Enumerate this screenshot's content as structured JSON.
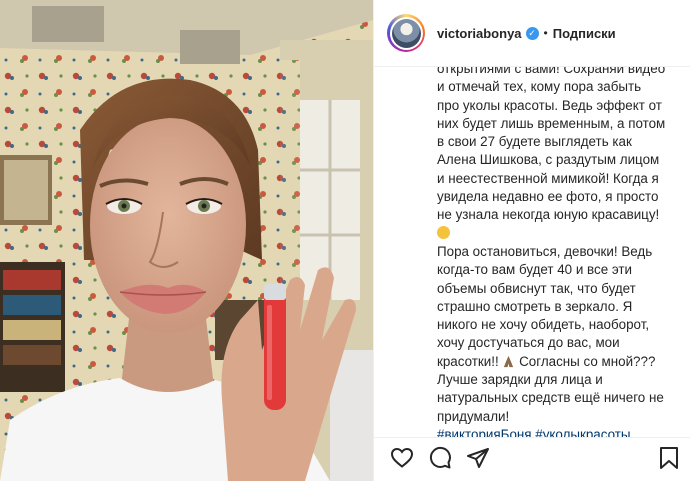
{
  "post": {
    "username": "victoriabonya",
    "separator": "•",
    "follow_label": "Подписки",
    "caption_lines": [
      "открытиями с вами! Сохраняй видео",
      "и отмечай тех, кому пора забыть",
      "про уколы красоты. Ведь эффект от",
      "них будет лишь временным, а потом",
      "в свои 27 будете выглядеть как",
      "Алена Шишкова, с раздутым лицом",
      "и неестественной мимикой! Когда я",
      "увидела недавно ее фото, я просто",
      "не узнала некогда юную красавицу!"
    ],
    "caption_lines_2": [
      "Пора остановиться, девочки! Ведь",
      "когда-то вам будет 40 и все эти",
      "объемы обвиснут так, что будет",
      "страшно смотреть в зеркало. Я",
      "никого не хочу обидеть, наоборот,",
      "хочу достучаться до вас, мои"
    ],
    "caption_line_pray_before": "красотки!! ",
    "caption_line_pray_after": " Согласны со мной???",
    "caption_lines_3": [
      "Лучше зарядки для лица и",
      "натуральных средств ещё ничего не",
      "придумали!"
    ],
    "hashtags": "#викторияБоня #уколыкрасоты"
  },
  "icons": {
    "like": "heart-icon",
    "comment": "comment-icon",
    "share": "paper-plane-icon",
    "save": "bookmark-icon",
    "verified": "verified-badge-icon"
  },
  "colors": {
    "text": "#262626",
    "hashtag": "#00376b",
    "verified": "#3897f0",
    "border": "#efefef"
  }
}
